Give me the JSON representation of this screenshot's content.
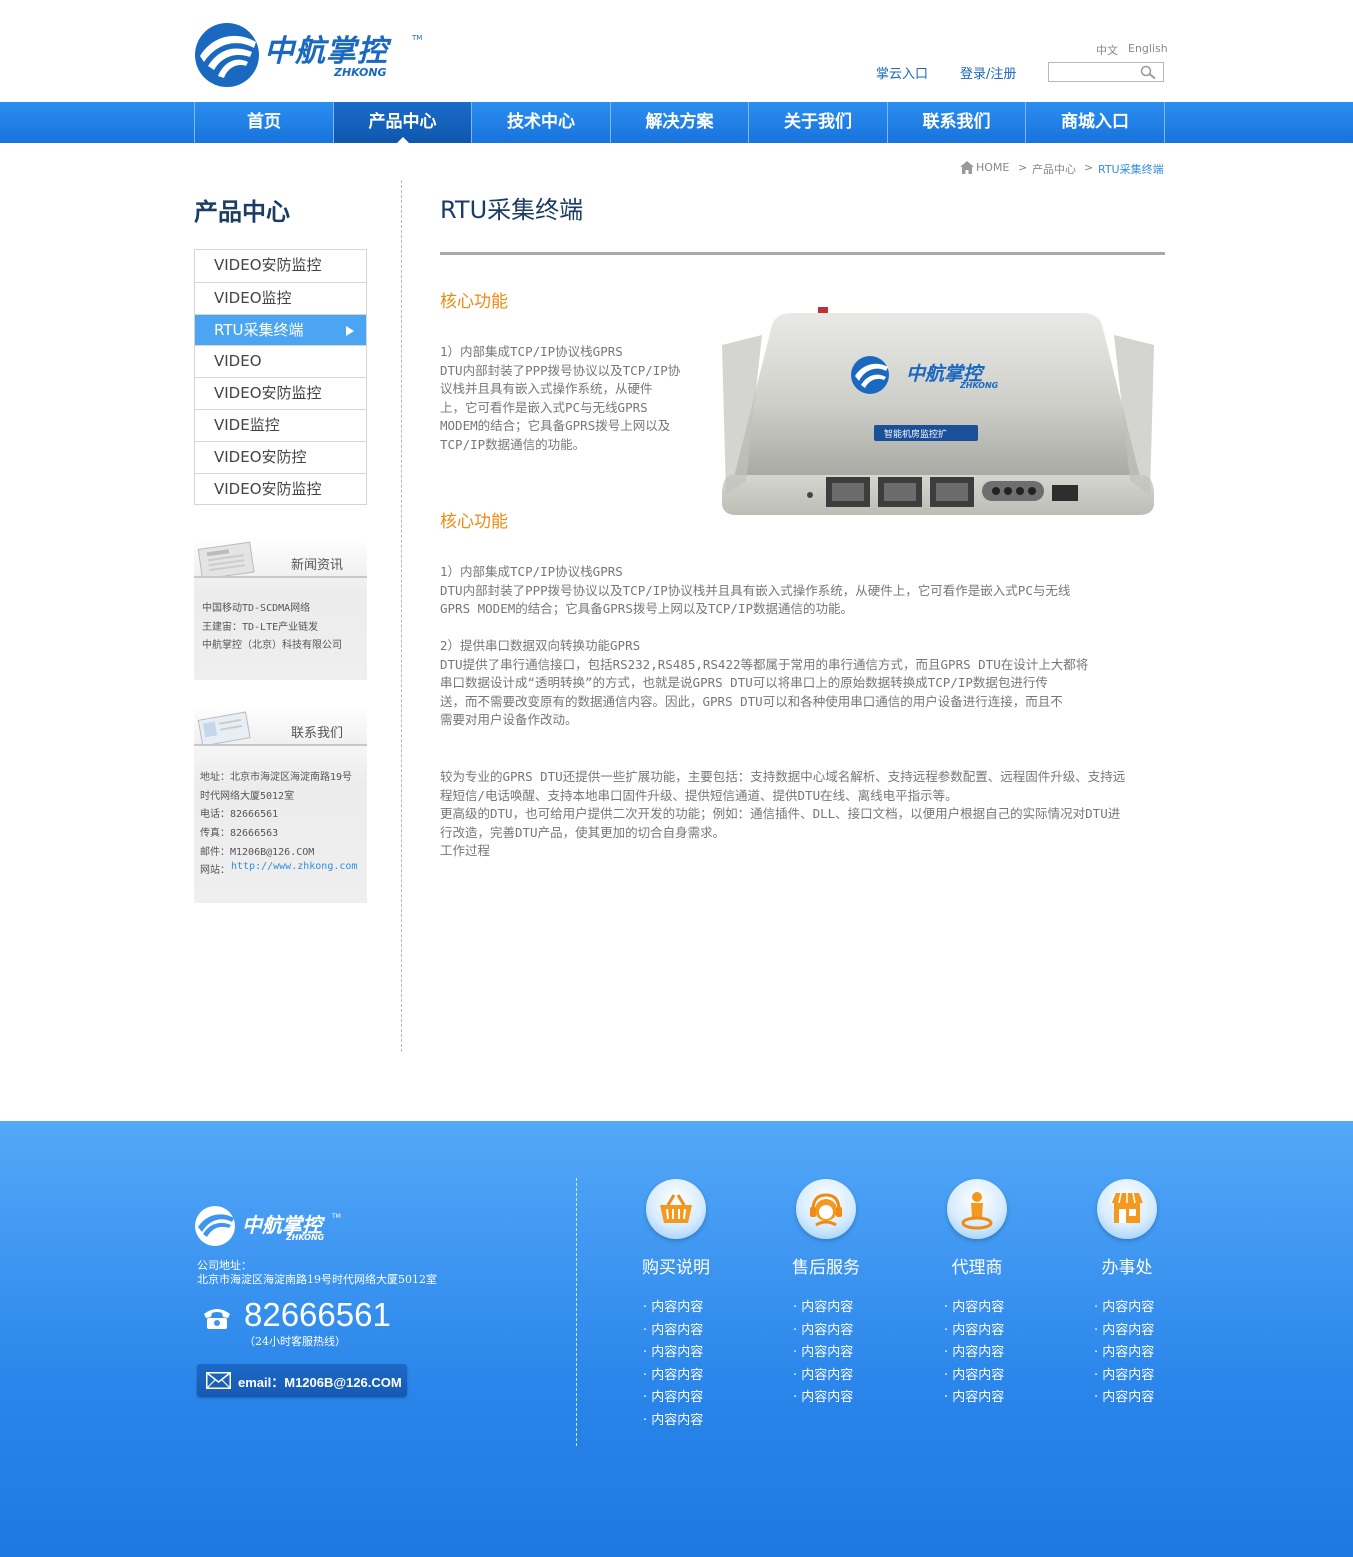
{
  "header": {
    "logo_cn": "中航掌控",
    "logo_en": "ZHKONG",
    "logo_tm": "TM",
    "lang_cn": "中文",
    "lang_en": "English",
    "cloud_link": "掌云入口",
    "login_link": "登录/注册",
    "search_placeholder": ""
  },
  "nav": {
    "items": [
      "首页",
      "产品中心",
      "技术中心",
      "解决方案",
      "关于我们",
      "联系我们",
      "商城入口"
    ],
    "active_index": 1
  },
  "breadcrumb": {
    "home": "HOME",
    "sep": ">",
    "level1": "产品中心",
    "current": "RTU采集终端"
  },
  "sidebar": {
    "title": "产品中心",
    "items": [
      "VIDEO安防监控",
      "VIDEO监控",
      "RTU采集终端",
      "VIDEO",
      "VIDEO安防监控",
      "VIDE监控",
      "VIDEO安防控",
      "VIDEO安防监控"
    ],
    "active_index": 2,
    "news": {
      "title": "新闻资讯",
      "lines": [
        "中国移动TD-SCDMA网络",
        "王建宙：TD-LTE产业链发",
        "中航掌控（北京）科技有限公司"
      ]
    },
    "contact": {
      "title": "联系我们",
      "address1": "地址：北京市海淀区海淀南路19号",
      "address2": "时代网络大厦5012室",
      "phone": "电话：82666561",
      "fax": "传真：82666563",
      "mail": "邮件：M1206B@126.COM",
      "web_label": "网站：",
      "web_url": "http://www.zhkong.com"
    }
  },
  "main": {
    "title": "RTU采集终端",
    "section1": {
      "heading": "核心功能",
      "lines": [
        "1）内部集成TCP/IP协议栈GPRS",
        "DTU内部封装了PPP拨号协议以及TCP/IP协",
        "议栈并且具有嵌入式操作系统，从硬件",
        "上，它可看作是嵌入式PC与无线GPRS",
        "MODEM的结合；它具备GPRS拨号上网以及",
        "TCP/IP数据通信的功能。"
      ]
    },
    "product_image": {
      "brand": "中航掌控",
      "brand_en": "ZHKONG",
      "label": "智能机房监控扩"
    },
    "section2": {
      "heading": "核心功能",
      "block1": [
        "1）内部集成TCP/IP协议栈GPRS",
        "DTU内部封装了PPP拨号协议以及TCP/IP协议栈并且具有嵌入式操作系统，从硬件上，它可看作是嵌入式PC与无线",
        "GPRS MODEM的结合；它具备GPRS拨号上网以及TCP/IP数据通信的功能。"
      ],
      "block2": [
        "2）提供串口数据双向转换功能GPRS",
        "DTU提供了串行通信接口，包括RS232,RS485,RS422等都属于常用的串行通信方式，而且GPRS  DTU在设计上大都将",
        "串口数据设计成“透明转换”的方式，也就是说GPRS    DTU可以将串口上的原始数据转换成TCP/IP数据包进行传",
        "送，而不需要改变原有的数据通信内容。因此，GPRS  DTU可以和各种使用串口通信的用户设备进行连接，而且不",
        "需要对用户设备作改动。"
      ],
      "block3": [
        "较为专业的GPRS  DTU还提供一些扩展功能，主要包括：支持数据中心域名解析、支持远程参数配置、远程固件升级、支持远",
        "程短信/电话唤醒、支持本地串口固件升级、提供短信通道、提供DTU在线、离线电平指示等。",
        "更高级的DTU，也可给用户提供二次开发的功能；例如：通信插件、DLL、接口文档，以便用户根据自己的实际情况对DTU进",
        "行改造，完善DTU产品，使其更加的切合自身需求。",
        "工作过程"
      ]
    }
  },
  "footer": {
    "logo_cn": "中航掌控",
    "logo_en": "ZHKONG",
    "logo_tm": "TM",
    "address_label": "公司地址：",
    "address": "北京市海淀区海淀南路19号时代网络大厦5012室",
    "phone": "82666561",
    "phone_note": "（24小时客服热线）",
    "email": "email：M1206B@126.COM",
    "columns": [
      {
        "title": "购买说明",
        "icon": "basket-icon",
        "items": [
          "· 内容内容",
          "· 内容内容",
          "· 内容内容",
          "· 内容内容",
          "· 内容内容",
          "· 内容内容"
        ]
      },
      {
        "title": "售后服务",
        "icon": "headset-icon",
        "items": [
          "· 内容内容",
          "· 内容内容",
          "· 内容内容",
          "· 内容内容",
          "· 内容内容"
        ]
      },
      {
        "title": "代理商",
        "icon": "agent-icon",
        "items": [
          "· 内容内容",
          "· 内容内容",
          "· 内容内容",
          "· 内容内容",
          "· 内容内容"
        ]
      },
      {
        "title": "办事处",
        "icon": "shop-icon",
        "items": [
          "· 内容内容",
          "· 内容内容",
          "· 内容内容",
          "· 内容内容",
          "· 内容内容"
        ]
      }
    ]
  },
  "colors": {
    "brand_blue": "#1a68c0",
    "nav_blue": "#1f7fe6",
    "accent_orange": "#f08a12",
    "sidebar_active": "#4ba5f2"
  }
}
